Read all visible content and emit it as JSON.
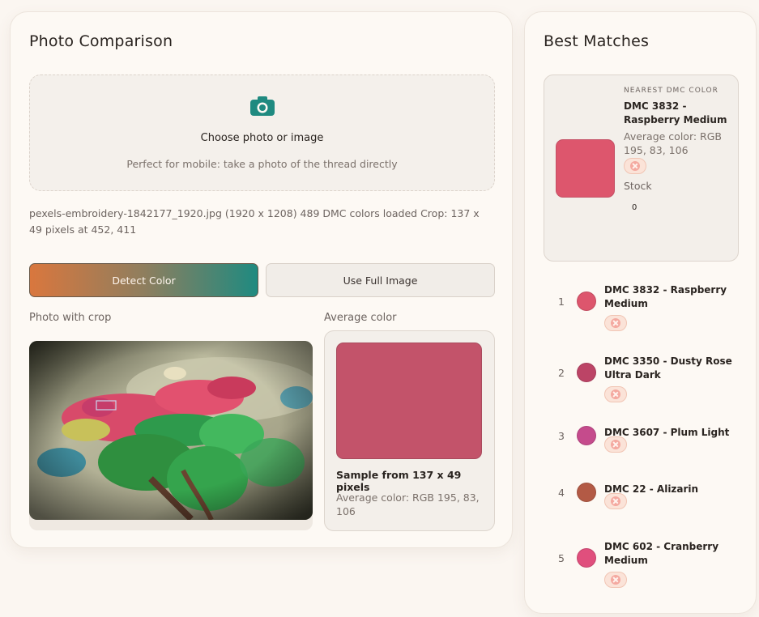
{
  "left_panel": {
    "title": "Photo Comparison",
    "upload": {
      "icon": "camera-icon",
      "label": "Choose photo or image",
      "hint": "Perfect for mobile: take a photo of the thread directly"
    },
    "file_info": "pexels-embroidery-1842177_1920.jpg (1920 x 1208) 489 DMC colors loaded Crop: 137 x 49 pixels at 452, 411",
    "buttons": {
      "detect": "Detect Color",
      "full_image": "Use Full Image"
    },
    "photo_label": "Photo with crop",
    "average_label": "Average color",
    "average": {
      "color": "#c3536a",
      "sample_text": "Sample from 137 x 49 pixels",
      "rgb_text": "Average color: RGB 195, 83, 106"
    }
  },
  "right_panel": {
    "title": "Best Matches",
    "nearest": {
      "kicker": "NEAREST DMC COLOR",
      "name": "DMC 3832 - Raspberry Medium",
      "rgb_text": "Average color: RGB 195, 83, 106",
      "color": "#dd566d",
      "stock_label": "Stock",
      "stock_value": "0"
    },
    "matches": [
      {
        "rank": "1",
        "name": "DMC 3832 - Raspberry Medium",
        "color": "#dd566d"
      },
      {
        "rank": "2",
        "name": "DMC 3350 - Dusty Rose Ultra Dark",
        "color": "#bc4466"
      },
      {
        "rank": "3",
        "name": "DMC 3607 - Plum Light",
        "color": "#c54b8c"
      },
      {
        "rank": "4",
        "name": "DMC 22 - Alizarin",
        "color": "#b35a45"
      },
      {
        "rank": "5",
        "name": "DMC 602 - Cranberry Medium",
        "color": "#e04f7d"
      }
    ]
  }
}
